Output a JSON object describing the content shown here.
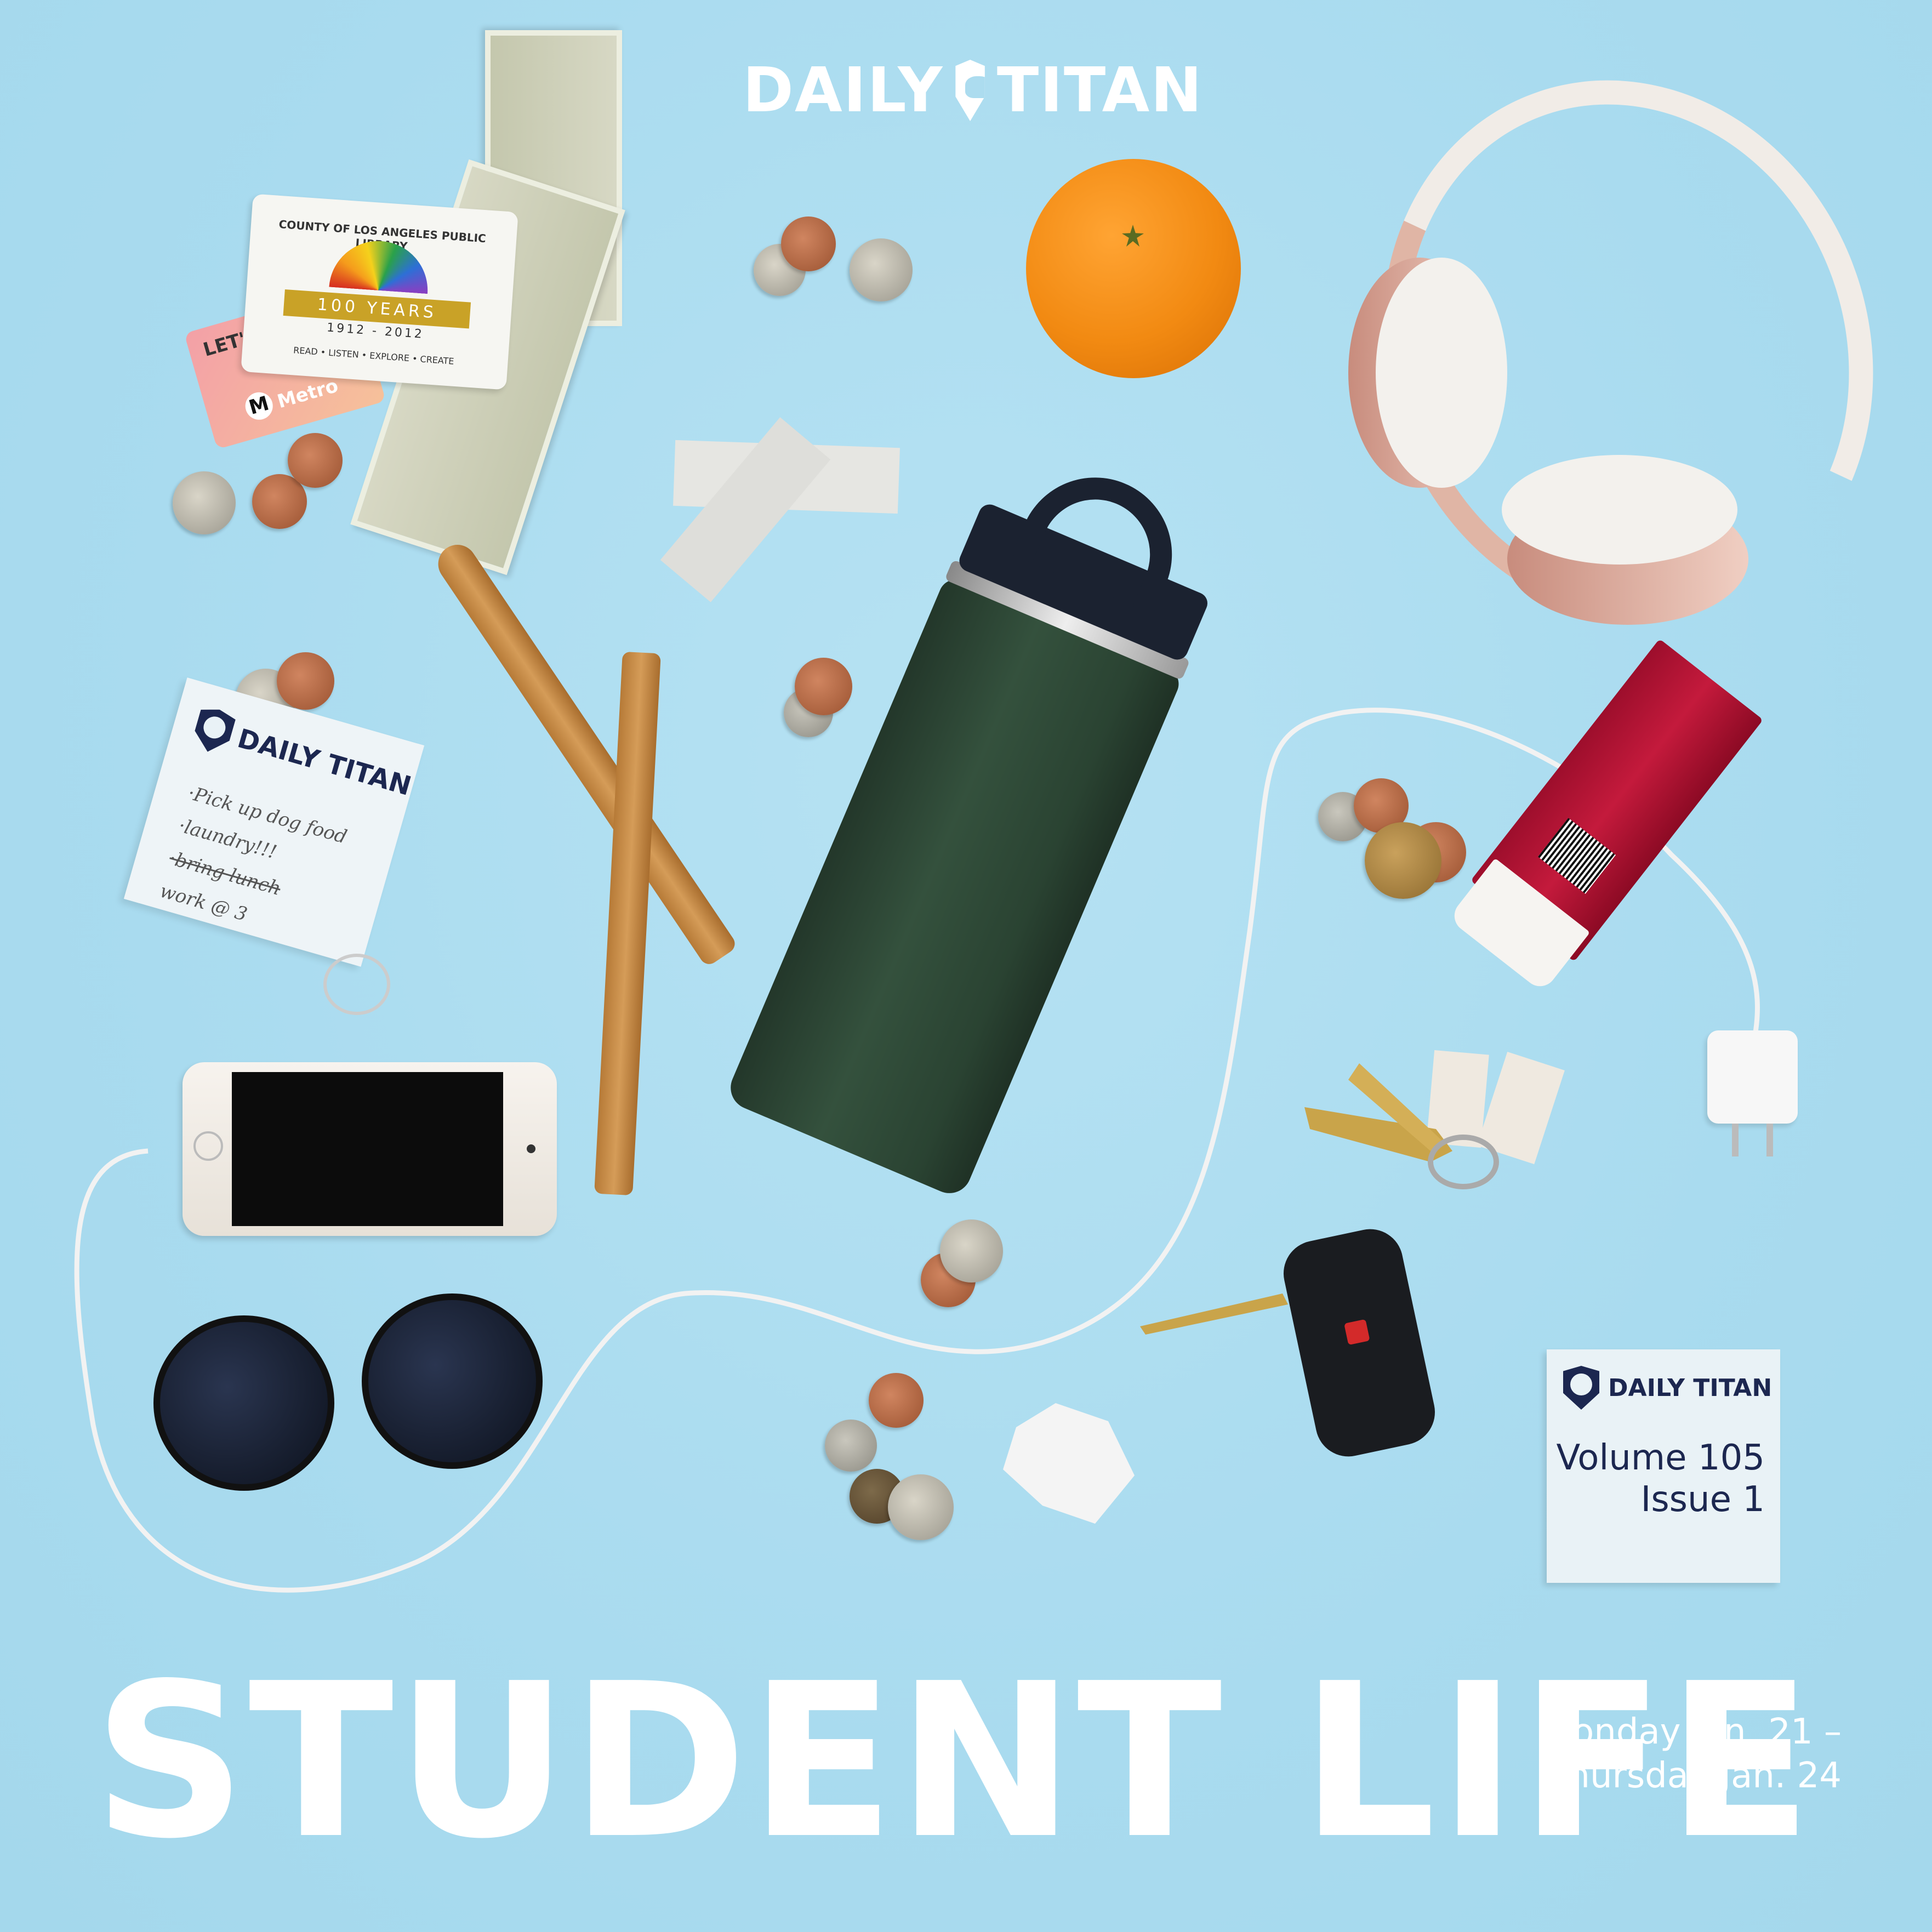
{
  "masthead": {
    "left": "DAILY",
    "right": "TITAN",
    "logo_icon": "elephant-shield-icon"
  },
  "headline": "STUDENT LIFE",
  "dates": {
    "line1": "Monday Jan. 21 –",
    "line2": "Thursday Jan. 24"
  },
  "volume_card": {
    "brand": "DAILY TITAN",
    "volume": "Volume 105",
    "issue": "Issue 1"
  },
  "note": {
    "brand": "DAILY TITAN",
    "items": [
      "·Pick up dog food",
      "·laundry!!!",
      "·bring lunch",
      "work @ 3"
    ]
  },
  "library_card": {
    "header": "COUNTY OF LOS ANGELES PUBLIC LIBRARY",
    "ribbon": "100 YEARS",
    "years": "1912 - 2012",
    "tagline": "READ • LISTEN • EXPLORE • CREATE"
  },
  "metro_card": {
    "lets": "LET'S",
    "logo": "M",
    "brand": "Metro"
  },
  "colors": {
    "background": "#acdcef",
    "headline": "#ffffff",
    "navy": "#1c2750",
    "orange": "#f28a12",
    "bottle": "#2f4a37"
  }
}
